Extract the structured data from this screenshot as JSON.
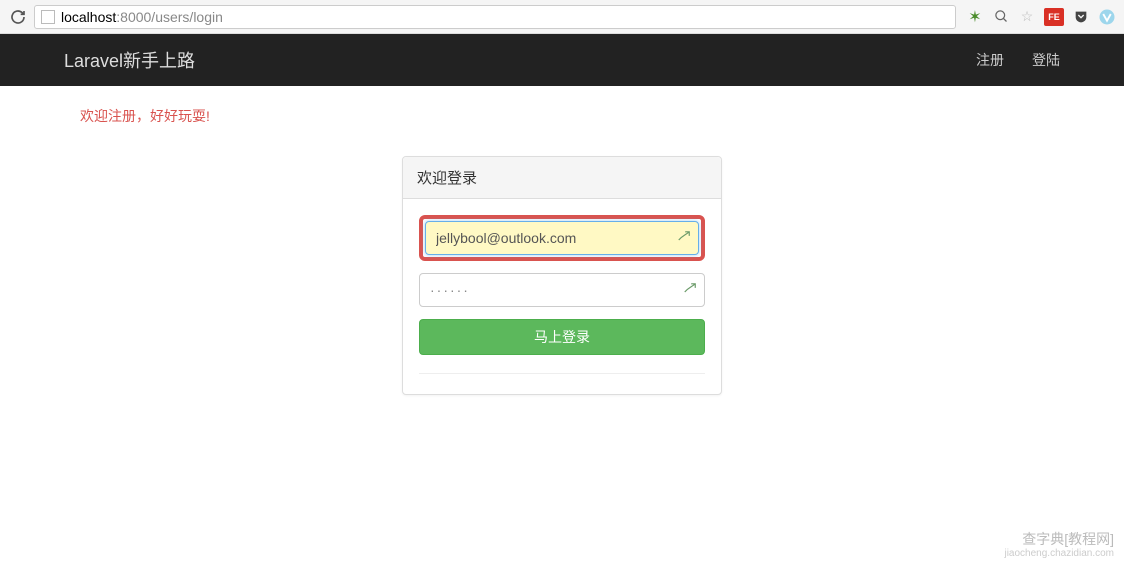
{
  "browser": {
    "url_host": "localhost",
    "url_port_path": ":8000/users/login",
    "ext_fe_label": "FE"
  },
  "navbar": {
    "brand": "Laravel新手上路",
    "register_label": "注册",
    "login_label": "登陆"
  },
  "flash_message": "欢迎注册，好好玩耍!",
  "login_form": {
    "panel_title": "欢迎登录",
    "email_value": "jellybool@outlook.com",
    "password_value": "······",
    "submit_label": "马上登录"
  },
  "watermark": {
    "line1": "查字典[教程网]",
    "line2": "jiaocheng.chazidian.com"
  }
}
